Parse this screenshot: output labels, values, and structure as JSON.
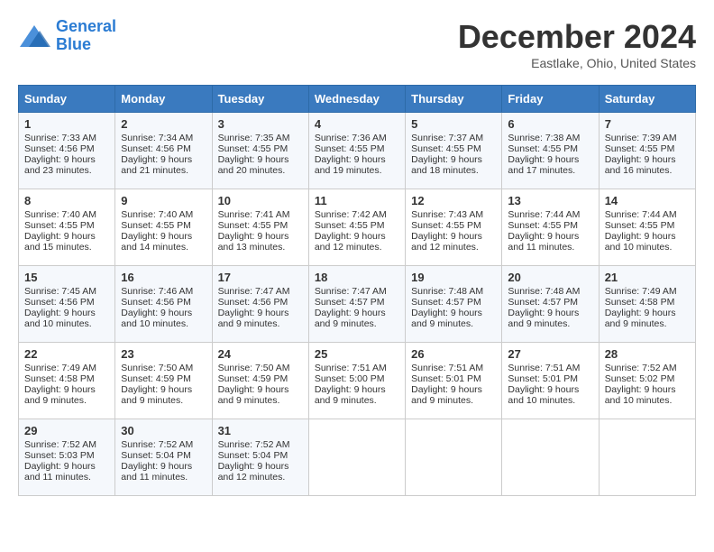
{
  "header": {
    "logo_line1": "General",
    "logo_line2": "Blue",
    "month_title": "December 2024",
    "location": "Eastlake, Ohio, United States"
  },
  "columns": [
    "Sunday",
    "Monday",
    "Tuesday",
    "Wednesday",
    "Thursday",
    "Friday",
    "Saturday"
  ],
  "weeks": [
    [
      {
        "day": "1",
        "lines": [
          "Sunrise: 7:33 AM",
          "Sunset: 4:56 PM",
          "Daylight: 9 hours",
          "and 23 minutes."
        ]
      },
      {
        "day": "2",
        "lines": [
          "Sunrise: 7:34 AM",
          "Sunset: 4:56 PM",
          "Daylight: 9 hours",
          "and 21 minutes."
        ]
      },
      {
        "day": "3",
        "lines": [
          "Sunrise: 7:35 AM",
          "Sunset: 4:55 PM",
          "Daylight: 9 hours",
          "and 20 minutes."
        ]
      },
      {
        "day": "4",
        "lines": [
          "Sunrise: 7:36 AM",
          "Sunset: 4:55 PM",
          "Daylight: 9 hours",
          "and 19 minutes."
        ]
      },
      {
        "day": "5",
        "lines": [
          "Sunrise: 7:37 AM",
          "Sunset: 4:55 PM",
          "Daylight: 9 hours",
          "and 18 minutes."
        ]
      },
      {
        "day": "6",
        "lines": [
          "Sunrise: 7:38 AM",
          "Sunset: 4:55 PM",
          "Daylight: 9 hours",
          "and 17 minutes."
        ]
      },
      {
        "day": "7",
        "lines": [
          "Sunrise: 7:39 AM",
          "Sunset: 4:55 PM",
          "Daylight: 9 hours",
          "and 16 minutes."
        ]
      }
    ],
    [
      {
        "day": "8",
        "lines": [
          "Sunrise: 7:40 AM",
          "Sunset: 4:55 PM",
          "Daylight: 9 hours",
          "and 15 minutes."
        ]
      },
      {
        "day": "9",
        "lines": [
          "Sunrise: 7:40 AM",
          "Sunset: 4:55 PM",
          "Daylight: 9 hours",
          "and 14 minutes."
        ]
      },
      {
        "day": "10",
        "lines": [
          "Sunrise: 7:41 AM",
          "Sunset: 4:55 PM",
          "Daylight: 9 hours",
          "and 13 minutes."
        ]
      },
      {
        "day": "11",
        "lines": [
          "Sunrise: 7:42 AM",
          "Sunset: 4:55 PM",
          "Daylight: 9 hours",
          "and 12 minutes."
        ]
      },
      {
        "day": "12",
        "lines": [
          "Sunrise: 7:43 AM",
          "Sunset: 4:55 PM",
          "Daylight: 9 hours",
          "and 12 minutes."
        ]
      },
      {
        "day": "13",
        "lines": [
          "Sunrise: 7:44 AM",
          "Sunset: 4:55 PM",
          "Daylight: 9 hours",
          "and 11 minutes."
        ]
      },
      {
        "day": "14",
        "lines": [
          "Sunrise: 7:44 AM",
          "Sunset: 4:55 PM",
          "Daylight: 9 hours",
          "and 10 minutes."
        ]
      }
    ],
    [
      {
        "day": "15",
        "lines": [
          "Sunrise: 7:45 AM",
          "Sunset: 4:56 PM",
          "Daylight: 9 hours",
          "and 10 minutes."
        ]
      },
      {
        "day": "16",
        "lines": [
          "Sunrise: 7:46 AM",
          "Sunset: 4:56 PM",
          "Daylight: 9 hours",
          "and 10 minutes."
        ]
      },
      {
        "day": "17",
        "lines": [
          "Sunrise: 7:47 AM",
          "Sunset: 4:56 PM",
          "Daylight: 9 hours",
          "and 9 minutes."
        ]
      },
      {
        "day": "18",
        "lines": [
          "Sunrise: 7:47 AM",
          "Sunset: 4:57 PM",
          "Daylight: 9 hours",
          "and 9 minutes."
        ]
      },
      {
        "day": "19",
        "lines": [
          "Sunrise: 7:48 AM",
          "Sunset: 4:57 PM",
          "Daylight: 9 hours",
          "and 9 minutes."
        ]
      },
      {
        "day": "20",
        "lines": [
          "Sunrise: 7:48 AM",
          "Sunset: 4:57 PM",
          "Daylight: 9 hours",
          "and 9 minutes."
        ]
      },
      {
        "day": "21",
        "lines": [
          "Sunrise: 7:49 AM",
          "Sunset: 4:58 PM",
          "Daylight: 9 hours",
          "and 9 minutes."
        ]
      }
    ],
    [
      {
        "day": "22",
        "lines": [
          "Sunrise: 7:49 AM",
          "Sunset: 4:58 PM",
          "Daylight: 9 hours",
          "and 9 minutes."
        ]
      },
      {
        "day": "23",
        "lines": [
          "Sunrise: 7:50 AM",
          "Sunset: 4:59 PM",
          "Daylight: 9 hours",
          "and 9 minutes."
        ]
      },
      {
        "day": "24",
        "lines": [
          "Sunrise: 7:50 AM",
          "Sunset: 4:59 PM",
          "Daylight: 9 hours",
          "and 9 minutes."
        ]
      },
      {
        "day": "25",
        "lines": [
          "Sunrise: 7:51 AM",
          "Sunset: 5:00 PM",
          "Daylight: 9 hours",
          "and 9 minutes."
        ]
      },
      {
        "day": "26",
        "lines": [
          "Sunrise: 7:51 AM",
          "Sunset: 5:01 PM",
          "Daylight: 9 hours",
          "and 9 minutes."
        ]
      },
      {
        "day": "27",
        "lines": [
          "Sunrise: 7:51 AM",
          "Sunset: 5:01 PM",
          "Daylight: 9 hours",
          "and 10 minutes."
        ]
      },
      {
        "day": "28",
        "lines": [
          "Sunrise: 7:52 AM",
          "Sunset: 5:02 PM",
          "Daylight: 9 hours",
          "and 10 minutes."
        ]
      }
    ],
    [
      {
        "day": "29",
        "lines": [
          "Sunrise: 7:52 AM",
          "Sunset: 5:03 PM",
          "Daylight: 9 hours",
          "and 11 minutes."
        ]
      },
      {
        "day": "30",
        "lines": [
          "Sunrise: 7:52 AM",
          "Sunset: 5:04 PM",
          "Daylight: 9 hours",
          "and 11 minutes."
        ]
      },
      {
        "day": "31",
        "lines": [
          "Sunrise: 7:52 AM",
          "Sunset: 5:04 PM",
          "Daylight: 9 hours",
          "and 12 minutes."
        ]
      },
      null,
      null,
      null,
      null
    ]
  ]
}
